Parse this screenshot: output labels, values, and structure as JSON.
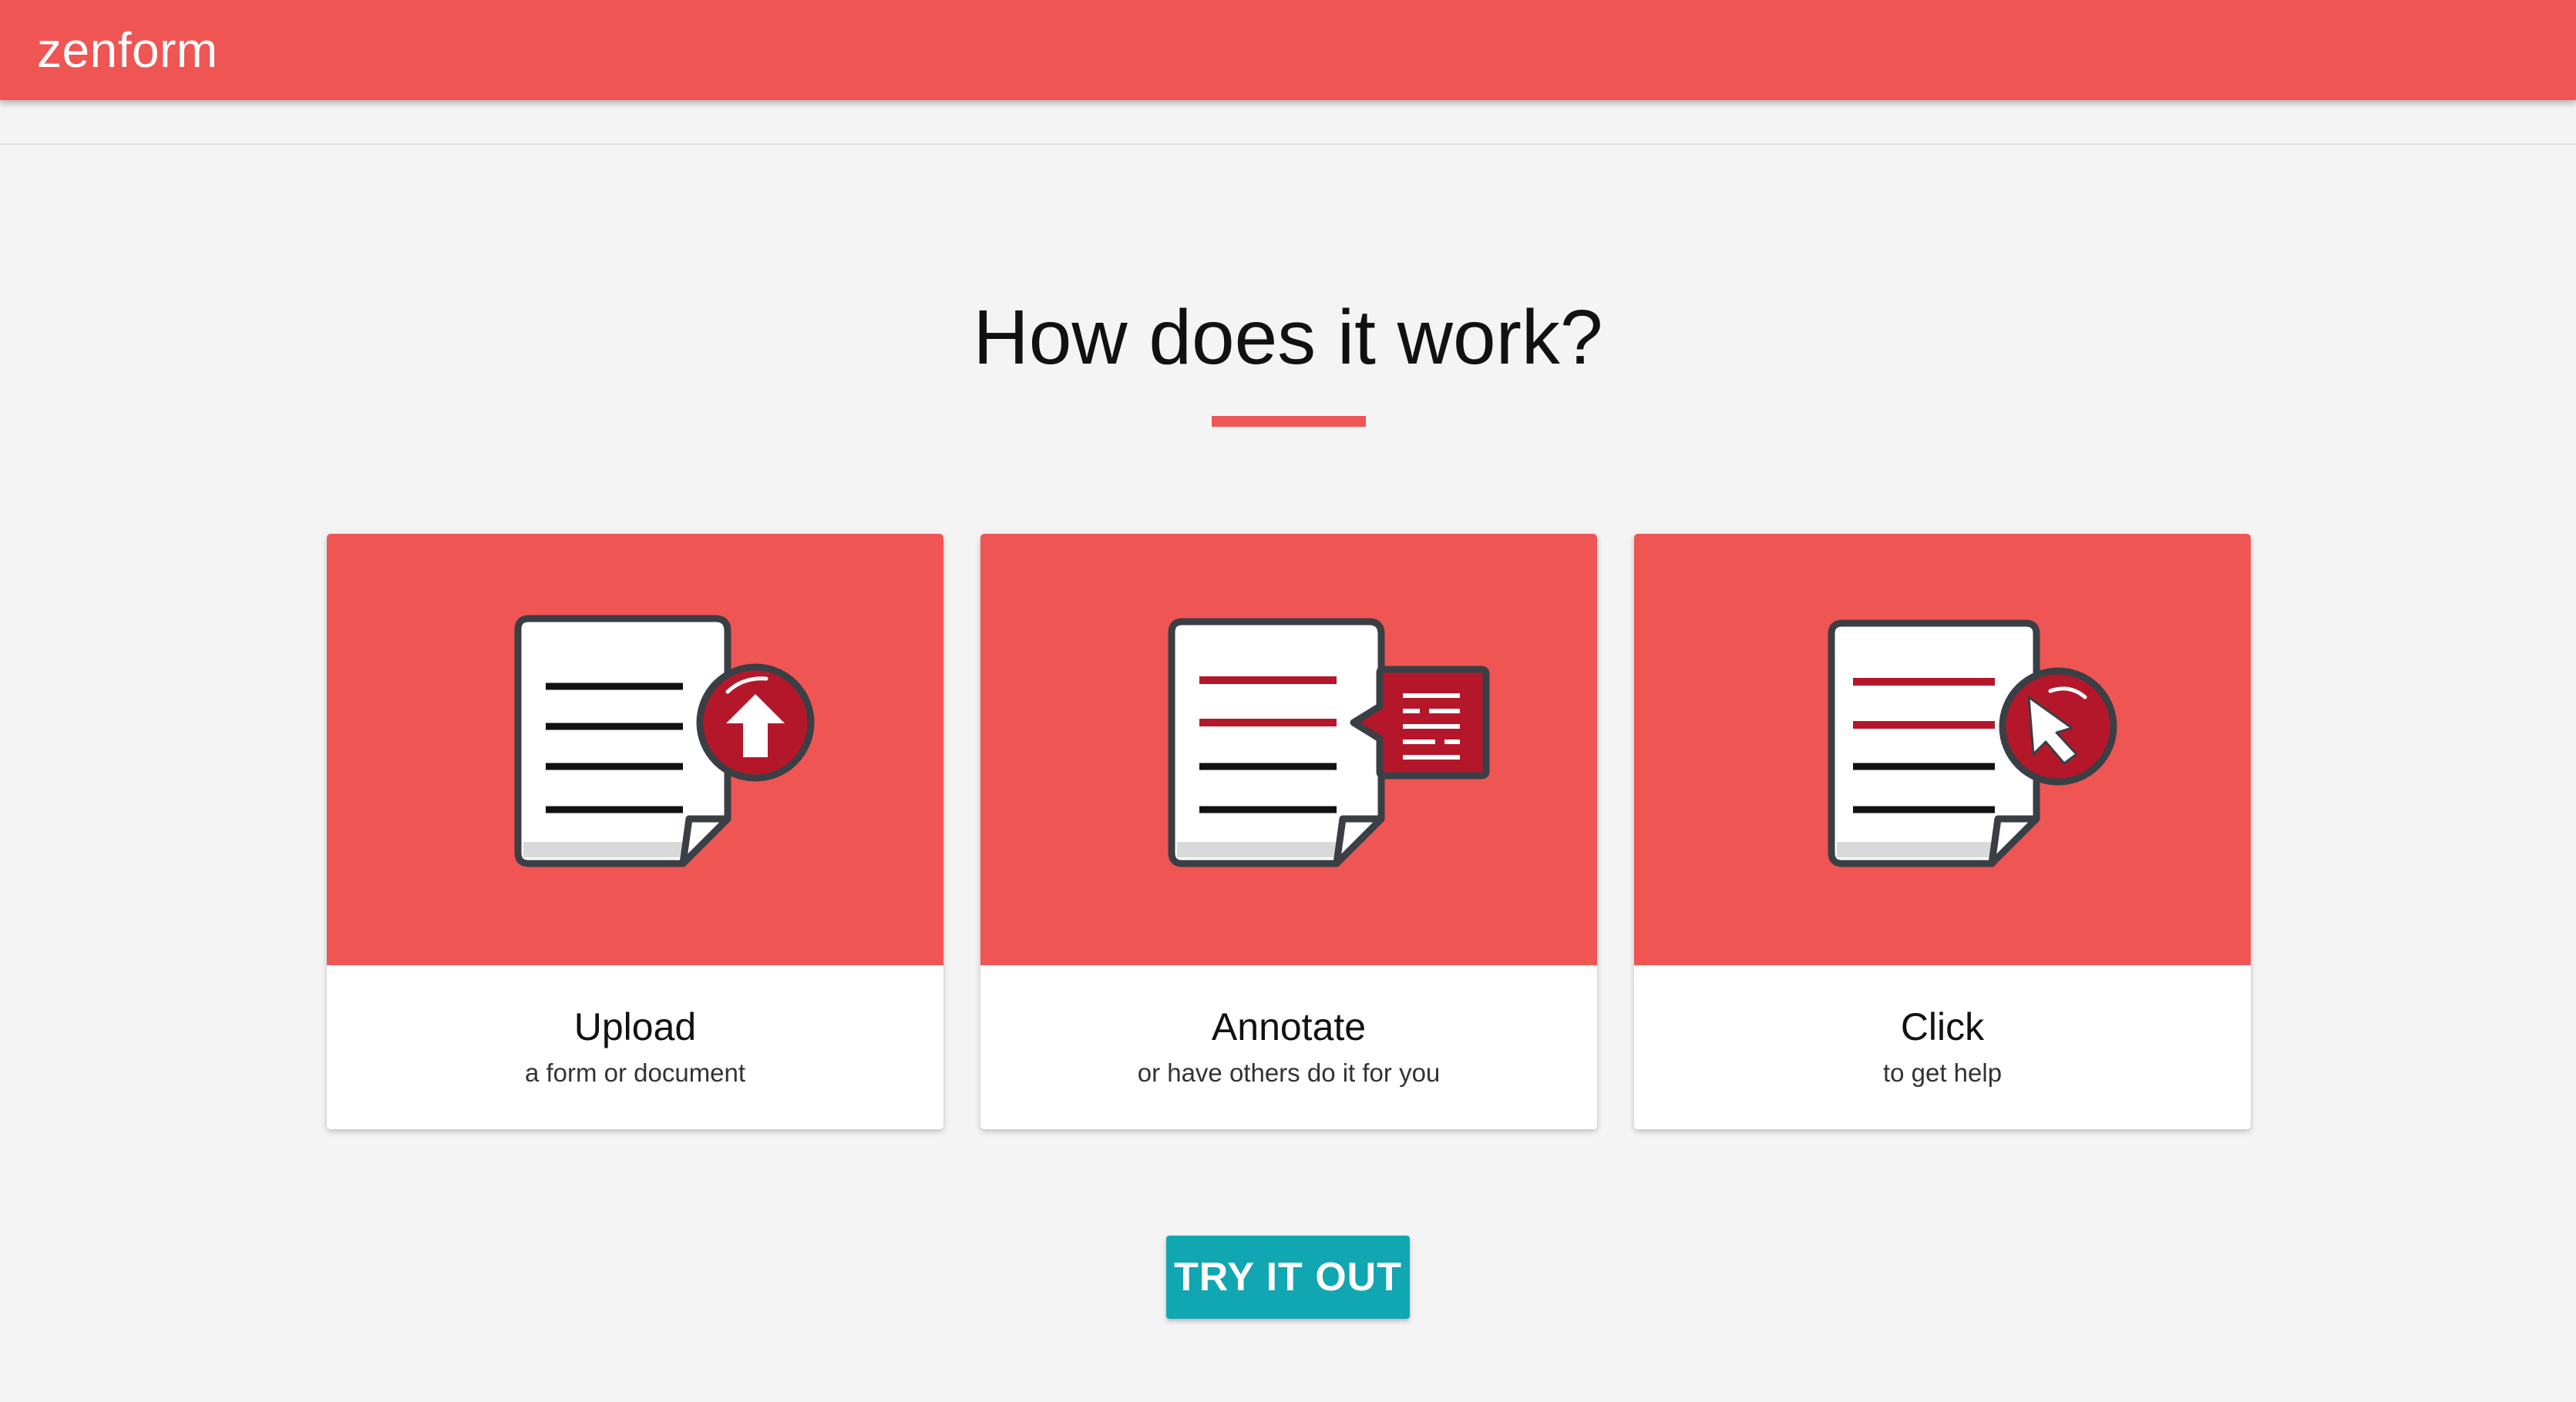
{
  "app": {
    "brand": "zenform"
  },
  "main": {
    "heading": "How does it work?",
    "steps": [
      {
        "title": "Upload",
        "subtitle": "a form or document",
        "icon": "document-upload-icon"
      },
      {
        "title": "Annotate",
        "subtitle": "or have others do it for you",
        "icon": "document-annotate-icon"
      },
      {
        "title": "Click",
        "subtitle": "to get help",
        "icon": "document-click-icon"
      }
    ],
    "cta_label": "TRY IT OUT"
  },
  "colors": {
    "brand_red": "#ef5553",
    "accent_dark_red": "#b5172a",
    "cta_teal": "#10a6b2",
    "background": "#f4f4f4"
  }
}
